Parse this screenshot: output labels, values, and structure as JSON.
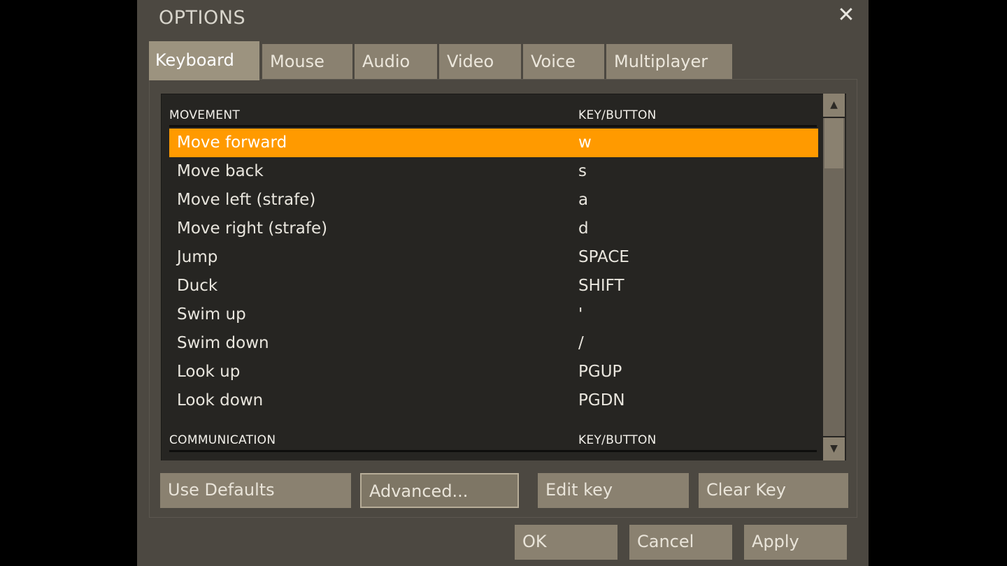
{
  "window": {
    "title": "OPTIONS"
  },
  "tabs": [
    {
      "label": "Keyboard",
      "active": true
    },
    {
      "label": "Mouse"
    },
    {
      "label": "Audio"
    },
    {
      "label": "Video"
    },
    {
      "label": "Voice"
    },
    {
      "label": "Multiplayer"
    }
  ],
  "sections": [
    {
      "title": "MOVEMENT",
      "key_header": "KEY/BUTTON",
      "rows": [
        {
          "action": "Move forward",
          "key": "w",
          "selected": true
        },
        {
          "action": "Move back",
          "key": "s"
        },
        {
          "action": "Move left (strafe)",
          "key": "a"
        },
        {
          "action": "Move right (strafe)",
          "key": "d"
        },
        {
          "action": "Jump",
          "key": "SPACE"
        },
        {
          "action": "Duck",
          "key": "SHIFT"
        },
        {
          "action": "Swim up",
          "key": "'"
        },
        {
          "action": "Swim down",
          "key": "/"
        },
        {
          "action": "Look up",
          "key": "PGUP"
        },
        {
          "action": "Look down",
          "key": "PGDN"
        }
      ]
    },
    {
      "title": "COMMUNICATION",
      "key_header": "KEY/BUTTON",
      "rows": []
    }
  ],
  "buttons": {
    "use_defaults": "Use Defaults",
    "advanced": "Advanced...",
    "edit_key": "Edit key",
    "clear_key": "Clear Key",
    "ok": "OK",
    "cancel": "Cancel",
    "apply": "Apply"
  },
  "icons": {
    "close": "close-icon",
    "scroll_up": "arrow-up-icon",
    "scroll_down": "arrow-down-icon"
  },
  "colors": {
    "selection": "#ff9a00",
    "dialog_bg": "#4c4841",
    "list_bg": "#262522",
    "button_bg": "#8a8170"
  }
}
